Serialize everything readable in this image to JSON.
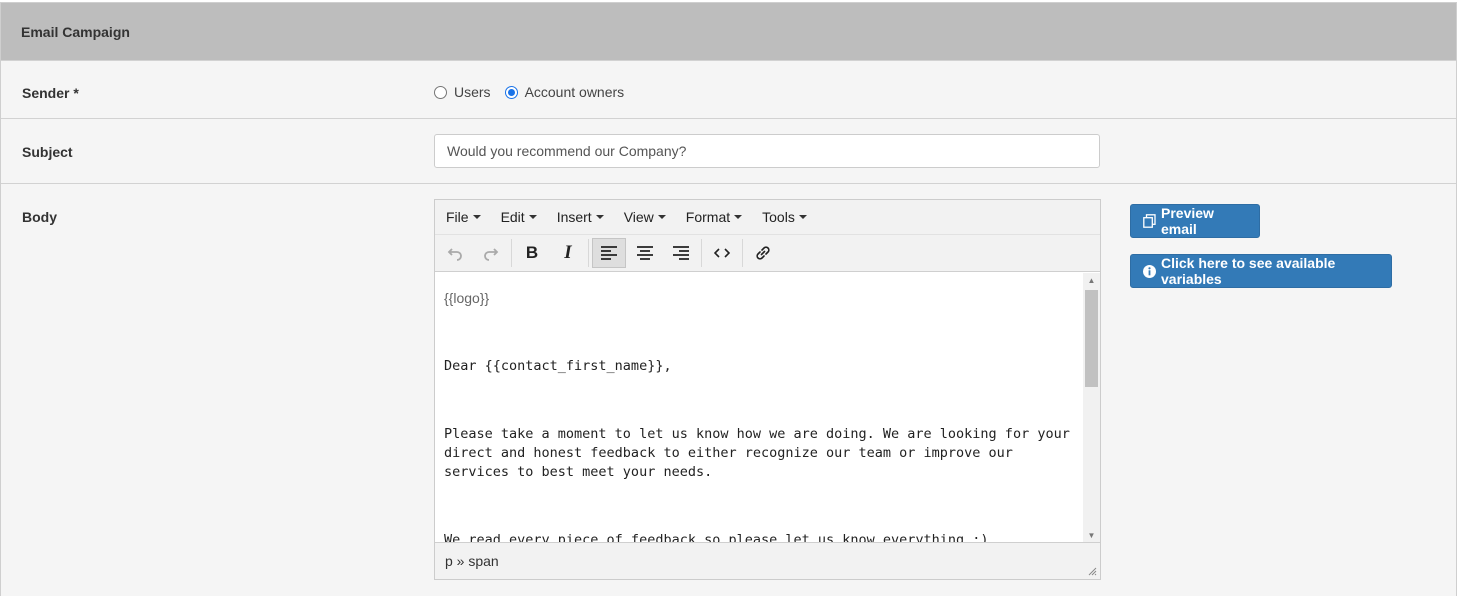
{
  "panel": {
    "title": "Email Campaign"
  },
  "sender": {
    "label": "Sender *",
    "options": [
      {
        "label": "Users",
        "checked": false
      },
      {
        "label": "Account owners",
        "checked": true
      }
    ]
  },
  "subject": {
    "label": "Subject",
    "value": "Would you recommend our Company?"
  },
  "body": {
    "label": "Body",
    "menus": [
      "File",
      "Edit",
      "Insert",
      "View",
      "Format",
      "Tools"
    ],
    "toolbar_icons": [
      "undo-icon",
      "redo-icon",
      "bold-icon",
      "italic-icon",
      "align-left-icon",
      "align-center-icon",
      "align-right-icon",
      "source-code-icon",
      "link-icon"
    ],
    "content": {
      "logo": "{{logo}}",
      "greeting": "Dear {{contact_first_name}},",
      "paragraph1": "Please take a moment to let us know how we are doing.  We are looking for your direct and honest feedback to either recognize our team or improve our services to best meet your needs.",
      "paragraph2": "We read every piece of feedback so please let us know everything :)"
    },
    "status_path": "p » span"
  },
  "actions": {
    "preview_label": "Preview email",
    "variables_label": "Click here to see available variables"
  },
  "colors": {
    "header_bg": "#bdbdbd",
    "primary": "#337ab7",
    "radio_checked": "#1a73e8"
  }
}
